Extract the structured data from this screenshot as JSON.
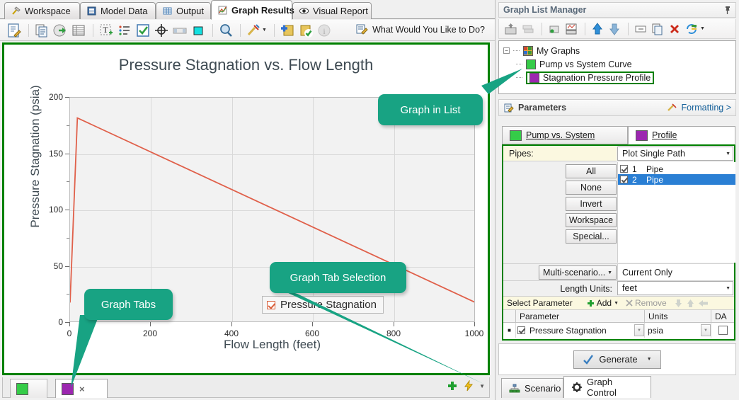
{
  "main_tabs": [
    {
      "label": "Workspace",
      "icon": "hammer-icon",
      "active": false
    },
    {
      "label": "Model Data",
      "icon": "notebook-icon",
      "active": false
    },
    {
      "label": "Output",
      "icon": "grid-icon",
      "active": false
    },
    {
      "label": "Graph Results",
      "icon": "graph-icon",
      "active": true
    },
    {
      "label": "Visual Report",
      "icon": "eye-icon",
      "active": false
    }
  ],
  "toolbar": {
    "icons": [
      "edit-document-icon",
      "copy-icon",
      "export-icon",
      "table-icon",
      "add-text-icon",
      "list-icon",
      "checkbox-icon",
      "crosshair-icon",
      "slider-icon",
      "color-swatch-icon",
      "zoom-icon",
      "format-icon",
      "add-graph-icon",
      "apply-graph-icon",
      "info-icon"
    ],
    "help_label": "What Would You Like to Do?",
    "help_icon": "wizard-icon"
  },
  "chart_data": {
    "type": "line",
    "title": "Pressure Stagnation vs. Flow Length",
    "xlabel": "Flow Length (feet)",
    "ylabel": "Pressure Stagnation (psia)",
    "xlim": [
      0,
      1000
    ],
    "ylim": [
      0,
      200
    ],
    "xticks": [
      0,
      200,
      400,
      600,
      800,
      1000
    ],
    "yticks": [
      0,
      50,
      100,
      150,
      200
    ],
    "y_minor_ticks": [
      25,
      75,
      125,
      175
    ],
    "grid": true,
    "legend_position": "inside-bottom-right",
    "series": [
      {
        "name": "Pressure Stagnation",
        "color": "#e0604a",
        "checked": true,
        "x": [
          0,
          18,
          1000
        ],
        "y": [
          18,
          182,
          18
        ]
      }
    ]
  },
  "graph_tabs": {
    "tabs": [
      {
        "icon": "green-graph-icon",
        "color": "#35cc48",
        "active": false,
        "closable": false
      },
      {
        "icon": "purple-graph-icon",
        "color": "#9c27b0",
        "active": true,
        "closable": true,
        "close_label": "×"
      }
    ],
    "add_icon": "plus-icon",
    "bolt_icon": "lightning-icon",
    "more_icon": "chevron-down-icon"
  },
  "graph_list_manager": {
    "title": "Graph List Manager",
    "pin_icon": "pin-icon",
    "toolbar_icons": [
      "load-icon",
      "copy-stack-icon",
      "new-folder-icon",
      "print-icon",
      "move-up-icon",
      "move-down-icon",
      "rename-icon",
      "duplicate-icon",
      "delete-icon",
      "refresh-icon"
    ],
    "tree": {
      "root": {
        "label": "My Graphs",
        "icon": "folder-graphs-icon",
        "expanded": true
      },
      "children": [
        {
          "label": "Pump vs System Curve",
          "icon": "green-graph-icon",
          "selected": false
        },
        {
          "label": "Stagnation Pressure Profile",
          "icon": "purple-graph-icon",
          "selected": true
        }
      ]
    }
  },
  "parameters": {
    "header": "Parameters",
    "header_icon": "pencil-pad-icon",
    "formatting_link": "Formatting >",
    "formatting_icon": "format-icon",
    "tabs": [
      {
        "label": "Pump vs. System",
        "underline_char": "P",
        "active": false,
        "color": "#35cc48"
      },
      {
        "label": "Profile",
        "underline_char": "P",
        "active": true,
        "color": "#9c27b0"
      }
    ],
    "pipes_label": "Pipes:",
    "plot_mode": "Plot Single Path",
    "buttons": [
      "All",
      "None",
      "Invert",
      "Workspace",
      "Special..."
    ],
    "pipe_list": [
      {
        "num": "1",
        "name": "Pipe",
        "checked": true,
        "selected": false
      },
      {
        "num": "2",
        "name": "Pipe",
        "checked": true,
        "selected": true
      }
    ],
    "multi_scenario_button": "Multi-scenario...",
    "multi_scenario_value": "Current Only",
    "length_units_label": "Length Units:",
    "length_units_value": "feet",
    "select_parameter_label": "Select Parameter",
    "add_label": "Add",
    "remove_label": "Remove",
    "add_icon": "plus-icon",
    "remove_icon": "x-icon",
    "move_down_icon": "down-arrow-icon",
    "move_up_icon": "up-arrow-icon",
    "move_back_icon": "left-arrow-icon",
    "table_headers": [
      "",
      "Parameter",
      "Units",
      "DA"
    ],
    "table_rows": [
      {
        "marker": "■",
        "checked": true,
        "parameter": "Pressure Stagnation",
        "units": "psia",
        "da": false
      }
    ],
    "generate_label": "Generate",
    "generate_icon": "check-icon"
  },
  "bottom_tabs": [
    {
      "label": "Scenario",
      "icon": "scenario-tree-icon",
      "active": false
    },
    {
      "label": "Graph Control",
      "icon": "gear-icon",
      "active": true
    }
  ],
  "callouts": [
    {
      "id": "graph-in-list",
      "text": "Graph in List"
    },
    {
      "id": "graph-tab-selection",
      "text": "Graph Tab Selection"
    },
    {
      "id": "graph-tabs",
      "text": "Graph Tabs"
    }
  ],
  "colors": {
    "accent_green": "#008000",
    "callout": "#18a383",
    "curve": "#e0604a",
    "selection_blue": "#2a7fd4"
  }
}
